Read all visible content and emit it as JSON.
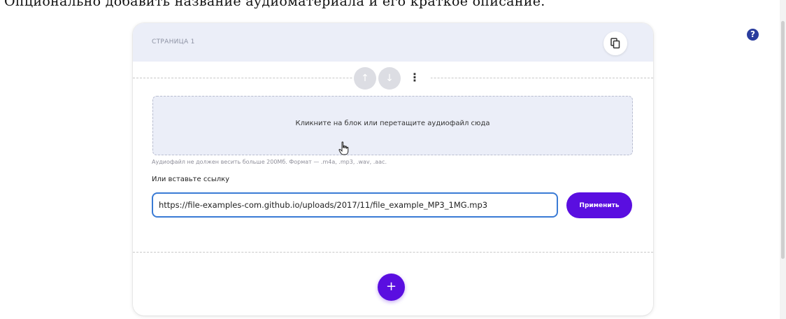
{
  "top_text": "Опционально добавить название аудиоматериала и его краткое описание.",
  "help_icon": "?",
  "card": {
    "page_title": "СТРАНИЦА 1",
    "controls": {
      "up": "↑",
      "down": "↓",
      "more": "⋮"
    },
    "dropzone_text": "Кликните на блок или перетащите аудиофайл сюда",
    "hint": "Аудиофайл не должен весить больше 200Мб. Формат — .m4a, .mp3, .wav, .aac.",
    "link_label": "Или вставьте ссылку",
    "url_value": "https://file-examples-com.github.io/uploads/2017/11/file_example_MP3_1MG.mp3",
    "apply_label": "Применить",
    "add_label": "+"
  },
  "icons": [
    "help-icon",
    "copy-icon",
    "arrow-up-icon",
    "arrow-down-icon",
    "more-vertical-icon",
    "hand-cursor-icon",
    "plus-icon"
  ],
  "colors": {
    "accent": "#5a0ee0",
    "header_bg": "#ebeef8",
    "input_border": "#3a7bd5",
    "help": "#2a3d9e"
  }
}
